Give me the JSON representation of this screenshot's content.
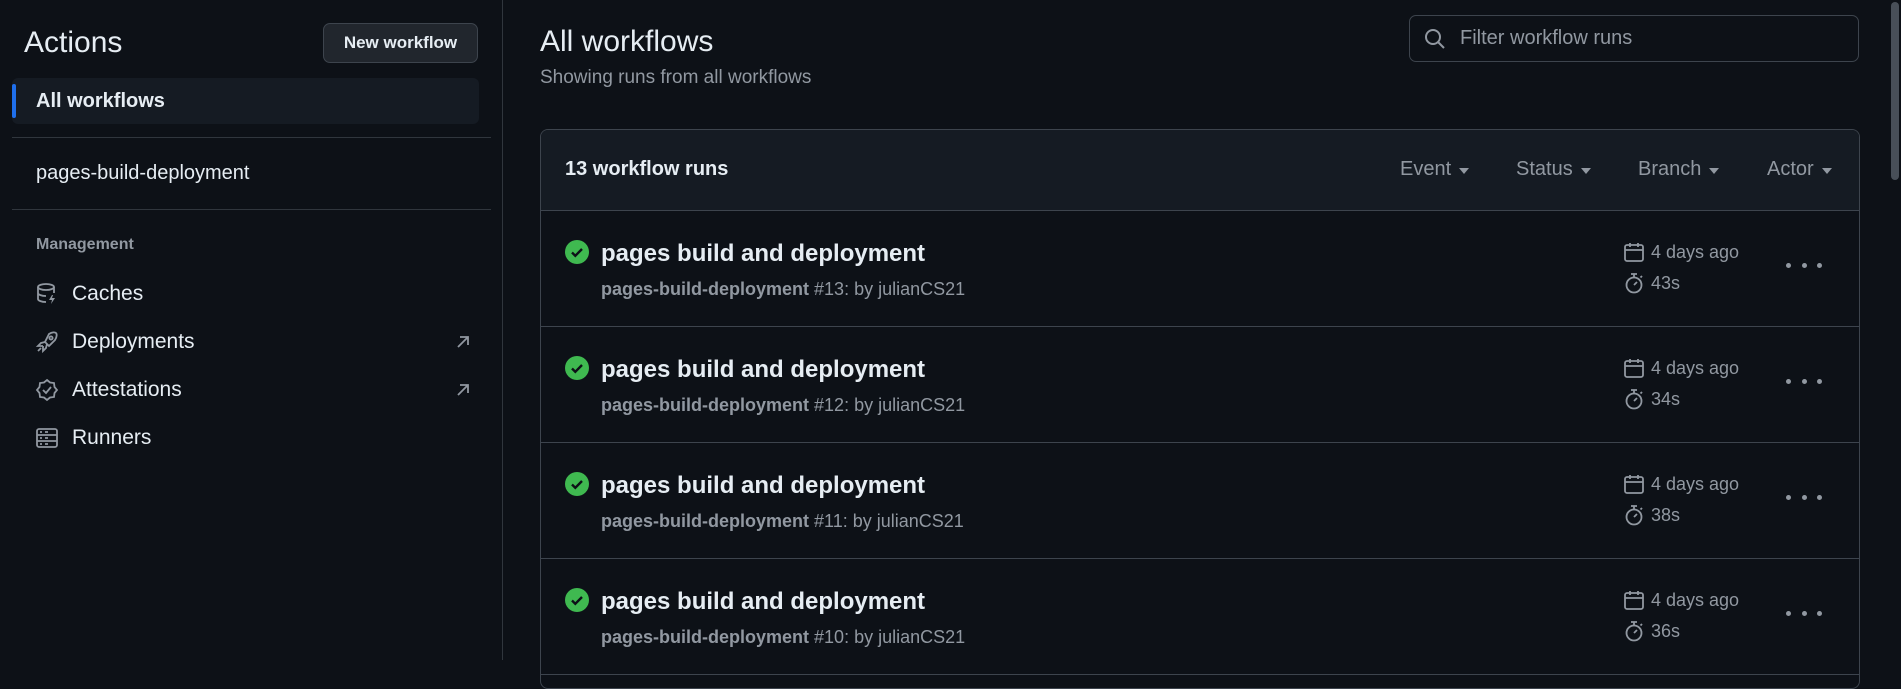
{
  "sidebar": {
    "title": "Actions",
    "new_workflow_label": "New workflow",
    "active_item": "All workflows",
    "workflow_item": "pages-build-deployment",
    "section_label": "Management",
    "items": [
      {
        "label": "Caches",
        "icon": "database-icon",
        "external": false
      },
      {
        "label": "Deployments",
        "icon": "rocket-icon",
        "external": true
      },
      {
        "label": "Attestations",
        "icon": "verified-icon",
        "external": true
      },
      {
        "label": "Runners",
        "icon": "server-icon",
        "external": false
      }
    ]
  },
  "main": {
    "title": "All workflows",
    "subtitle": "Showing runs from all workflows",
    "search_placeholder": "Filter workflow runs"
  },
  "runs_header": {
    "count_label": "13 workflow runs",
    "filters": [
      "Event",
      "Status",
      "Branch",
      "Actor"
    ]
  },
  "runs": [
    {
      "title": "pages build and deployment",
      "workflow": "pages-build-deployment",
      "detail": "#13: by julianCS21",
      "when": "4 days ago",
      "duration": "43s",
      "status": "success"
    },
    {
      "title": "pages build and deployment",
      "workflow": "pages-build-deployment",
      "detail": "#12: by julianCS21",
      "when": "4 days ago",
      "duration": "34s",
      "status": "success"
    },
    {
      "title": "pages build and deployment",
      "workflow": "pages-build-deployment",
      "detail": "#11: by julianCS21",
      "when": "4 days ago",
      "duration": "38s",
      "status": "success"
    },
    {
      "title": "pages build and deployment",
      "workflow": "pages-build-deployment",
      "detail": "#10: by julianCS21",
      "when": "4 days ago",
      "duration": "36s",
      "status": "success"
    }
  ],
  "colors": {
    "background": "#0d1117",
    "accent": "#1f6feb",
    "success": "#3fb950",
    "muted_text": "#9198a1"
  }
}
